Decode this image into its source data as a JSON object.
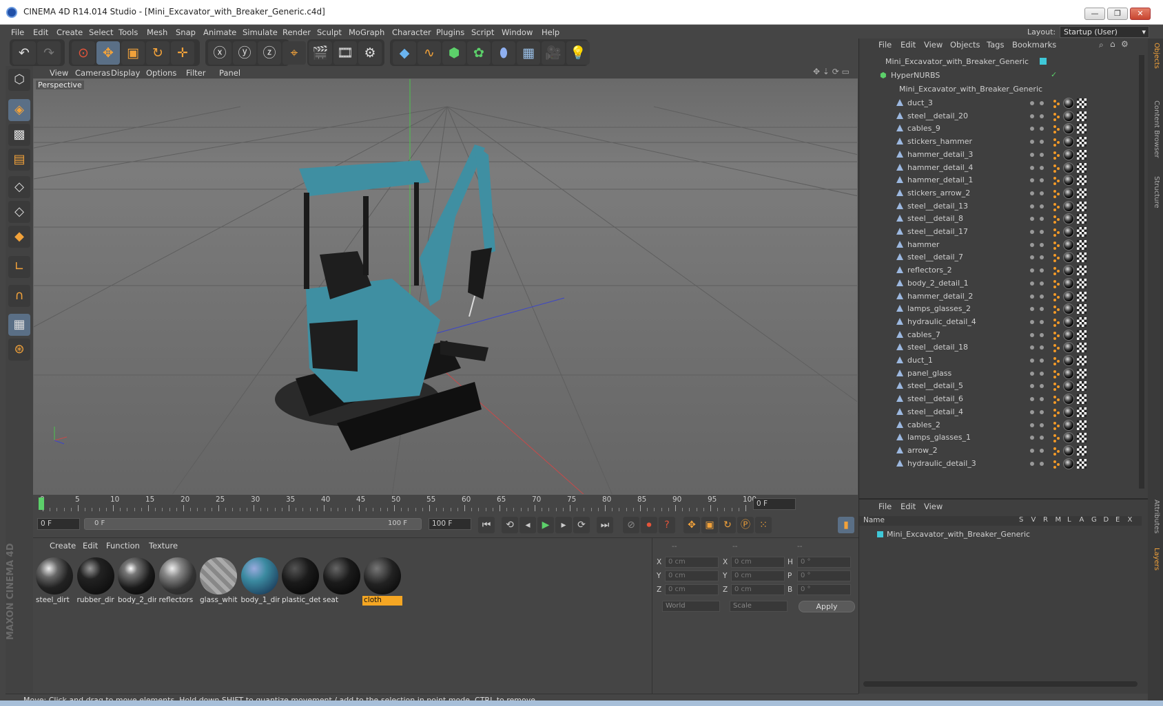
{
  "window": {
    "title": "CINEMA 4D R14.014 Studio - [Mini_Excavator_with_Breaker_Generic.c4d]",
    "controls": [
      "—",
      "❐",
      "✕"
    ]
  },
  "menu": [
    "File",
    "Edit",
    "Create",
    "Select",
    "Tools",
    "Mesh",
    "Snap",
    "Animate",
    "Simulate",
    "Render",
    "Sculpt",
    "MoGraph",
    "Character",
    "Plugins",
    "Script",
    "Window",
    "Help"
  ],
  "layout": {
    "label": "Layout:",
    "value": "Startup (User)"
  },
  "viewport": {
    "menu": [
      "View",
      "Cameras",
      "Display",
      "Options",
      "Filter",
      "Panel"
    ],
    "label": "Perspective"
  },
  "timeline": {
    "ticks": [
      "0",
      "5",
      "10",
      "15",
      "20",
      "25",
      "30",
      "35",
      "40",
      "45",
      "50",
      "55",
      "60",
      "65",
      "70",
      "75",
      "80",
      "85",
      "90",
      "95",
      "100"
    ],
    "current_frame": "0 F",
    "start_field": "0 F",
    "range_start": "0 F",
    "range_end": "100 F",
    "end_field": "100 F"
  },
  "materials": {
    "menu": [
      "Create",
      "Edit",
      "Function",
      "Texture"
    ],
    "items": [
      {
        "name": "steel_dirt"
      },
      {
        "name": "rubber_dir"
      },
      {
        "name": "body_2_dir"
      },
      {
        "name": "reflectors"
      },
      {
        "name": "glass_whit"
      },
      {
        "name": "body_1_dir"
      },
      {
        "name": "plastic_det"
      },
      {
        "name": "seat"
      },
      {
        "name": "cloth"
      }
    ]
  },
  "coords": {
    "headers": [
      "--",
      "--",
      "--"
    ],
    "rows": [
      {
        "a": "X",
        "av": "0 cm",
        "b": "X",
        "bv": "0 cm",
        "c": "H",
        "cv": "0 °"
      },
      {
        "a": "Y",
        "av": "0 cm",
        "b": "Y",
        "bv": "0 cm",
        "c": "P",
        "cv": "0 °"
      },
      {
        "a": "Z",
        "av": "0 cm",
        "b": "Z",
        "bv": "0 cm",
        "c": "B",
        "cv": "0 °"
      }
    ],
    "space": "World",
    "mode": "Scale",
    "apply": "Apply"
  },
  "status": "Move: Click and drag to move elements. Hold down SHIFT to quantize movement / add to the selection in point mode, CTRL to remove.",
  "objects": {
    "menu": [
      "File",
      "Edit",
      "View",
      "Objects",
      "Tags",
      "Bookmarks"
    ],
    "root": "Mini_Excavator_with_Breaker_Generic",
    "hypernurbs": "HyperNURBS",
    "group": "Mini_Excavator_with_Breaker_Generic",
    "items": [
      "duct_3",
      "steel__detail_20",
      "cables_9",
      "stickers_hammer",
      "hammer_detail_3",
      "hammer_detail_4",
      "hammer_detail_1",
      "stickers_arrow_2",
      "steel__detail_13",
      "steel__detail_8",
      "steel__detail_17",
      "hammer",
      "steel__detail_7",
      "reflectors_2",
      "body_2_detail_1",
      "hammer_detail_2",
      "lamps_glasses_2",
      "hydraulic_detail_4",
      "cables_7",
      "steel__detail_18",
      "duct_1",
      "panel_glass",
      "steel__detail_5",
      "steel__detail_6",
      "steel__detail_4",
      "cables_2",
      "lamps_glasses_1",
      "arrow_2",
      "hydraulic_detail_3"
    ]
  },
  "layers": {
    "menu": [
      "File",
      "Edit",
      "View"
    ],
    "columns": [
      "Name",
      "S",
      "V",
      "R",
      "M",
      "L",
      "A",
      "G",
      "D",
      "E",
      "X"
    ],
    "row": "Mini_Excavator_with_Breaker_Generic"
  },
  "side_tabs": [
    "Objects",
    "Content Browser",
    "Structure",
    "Attributes",
    "Layers"
  ],
  "brand": "MAXON CINEMA 4D",
  "colors": {
    "accent": "#3a8fa0",
    "selection": "#f5a623",
    "ui_bg": "#454545"
  }
}
